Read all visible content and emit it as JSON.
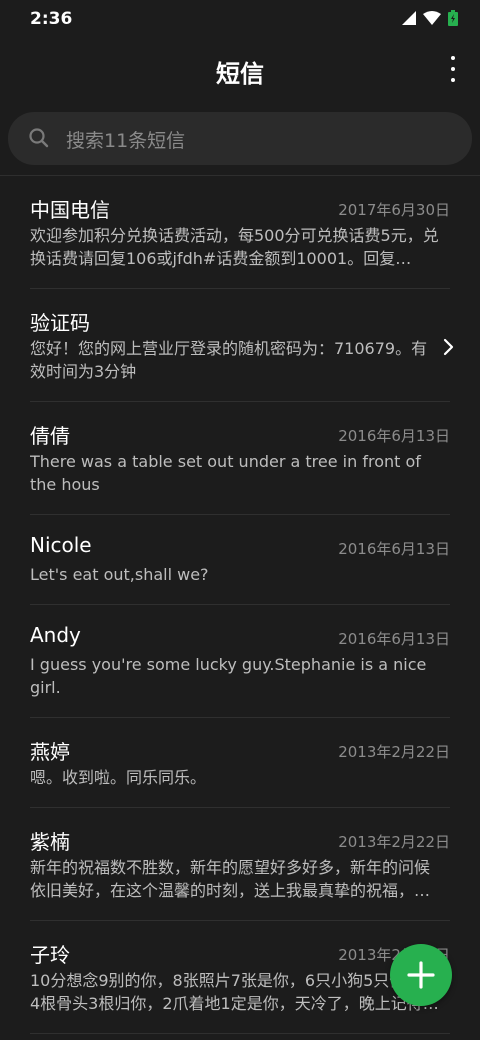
{
  "status_bar": {
    "time": "2:36"
  },
  "header": {
    "title": "短信"
  },
  "search": {
    "placeholder": "搜索11条短信"
  },
  "colors": {
    "background": "#1c1c1c",
    "search_bg": "#2b2b2b",
    "fab": "#27b04f",
    "battery": "#27b04f"
  },
  "conversations": [
    {
      "name": "中国电信",
      "date": "2017年6月30日",
      "preview": "欢迎参加积分兑换话费活动，每500分可兑换话费5元，兑换话费请回复106或jfdh#话费金额到10001。回复…"
    },
    {
      "name": "验证码",
      "date": "",
      "preview": "您好！您的网上营业厅登录的随机密码为：710679。有效时间为3分钟"
    },
    {
      "name": "倩倩",
      "date": "2016年6月13日",
      "preview": "There was a table set out under a tree in front of the hous"
    },
    {
      "name": "Nicole",
      "date": "2016年6月13日",
      "preview": "Let's eat out,shall we?"
    },
    {
      "name": "Andy",
      "date": "2016年6月13日",
      "preview": "I guess you're some lucky guy.Stephanie is a nice girl."
    },
    {
      "name": "燕婷",
      "date": "2013年2月22日",
      "preview": "嗯。收到啦。同乐同乐。"
    },
    {
      "name": "紫楠",
      "date": "2013年2月22日",
      "preview": "新年的祝福数不胜数，新年的愿望好多好多，新年的问候依旧美好，在这个温馨的时刻，送上我最真挚的祝福，…"
    },
    {
      "name": "子玲",
      "date": "2013年2月22日",
      "preview": "10分想念9别的你，8张照片7张是你，6只小狗5只像你，4根骨头3根归你，2爪着地1定是你，天冷了，晚上记得…"
    }
  ],
  "icons": {
    "signal": "signal-icon",
    "wifi": "wifi-icon",
    "battery": "battery-icon",
    "more": "more-vertical-icon",
    "search": "search-icon",
    "chevron": "chevron-right-icon",
    "compose": "plus-icon"
  }
}
